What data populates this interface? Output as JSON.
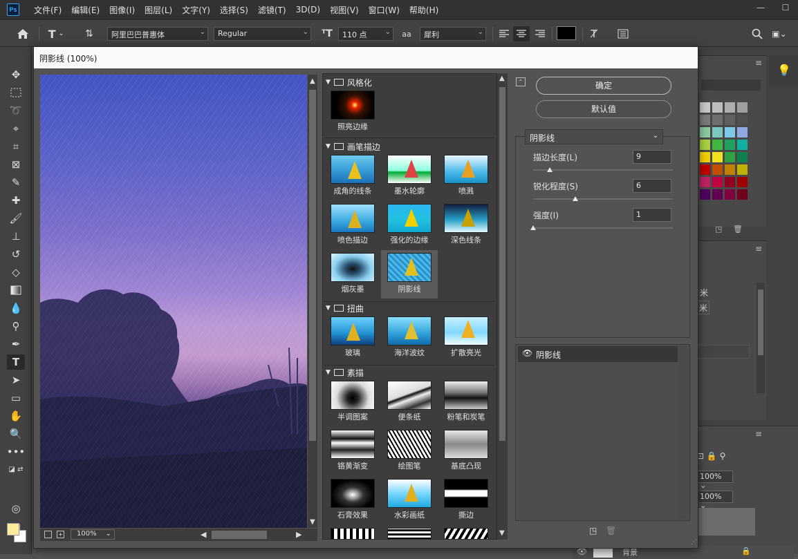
{
  "menu": {
    "logo": "Ps",
    "items": [
      "文件(F)",
      "编辑(E)",
      "图像(I)",
      "图层(L)",
      "文字(Y)",
      "选择(S)",
      "滤镜(T)",
      "3D(D)",
      "视图(V)",
      "窗口(W)",
      "帮助(H)"
    ]
  },
  "window_controls": {
    "minimize": "—",
    "maximize": "☐"
  },
  "options": {
    "font_family": "阿里巴巴普惠体",
    "font_style": "Regular",
    "font_size": "110 点",
    "aa_label": "aa",
    "antialias": "犀利",
    "color": "#000000"
  },
  "dialog": {
    "title": "阴影线 (100%)",
    "ok": "确定",
    "default": "默认值",
    "zoom": "100%",
    "categories": [
      {
        "name": "风格化",
        "filters": [
          "照亮边缘"
        ]
      },
      {
        "name": "画笔描边",
        "filters": [
          "成角的线条",
          "墨水轮廓",
          "喷溅",
          "喷色描边",
          "强化的边缘",
          "深色线条",
          "烟灰墨",
          "阴影线"
        ]
      },
      {
        "name": "扭曲",
        "filters": [
          "玻璃",
          "海洋波纹",
          "扩散亮光"
        ]
      },
      {
        "name": "素描",
        "filters": [
          "半调图案",
          "便条纸",
          "粉笔和炭笔",
          "铬黄渐变",
          "绘图笔",
          "基底凸现",
          "石膏效果",
          "水彩画纸",
          "撕边"
        ]
      }
    ],
    "selected_filter": "阴影线",
    "params": [
      {
        "label": "描边长度(L)",
        "value": "9",
        "fraction": 0.12
      },
      {
        "label": "锐化程度(S)",
        "value": "6",
        "fraction": 0.3
      },
      {
        "label": "强度(I)",
        "value": "1",
        "fraction": 0.0
      }
    ],
    "layer_name": "阴影线"
  },
  "right_panel": {
    "text1": "米",
    "text2": "米",
    "zoom1": "100%",
    "zoom2": "100%",
    "layer_bg": "背景"
  },
  "colors": {
    "foreground": "#ffeb9c",
    "background": "#ffffff"
  }
}
